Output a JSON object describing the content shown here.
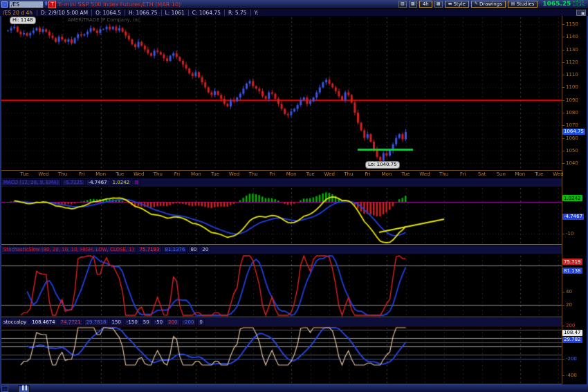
{
  "title_bar": {
    "symbol": "/ES",
    "instrument_badge": "T",
    "title": "E-mini S&P 500 Index Futures,ETH (MAR 10)",
    "timeframe_button": "4h",
    "style_button": "Style",
    "drawings_button": "Drawings",
    "studies_button": "Studies",
    "last_price": "1065.25",
    "change": "+4.25",
    "change_pct": "+0.4%"
  },
  "data_bar": {
    "symbol_info": "/ES 20 d 4h",
    "fields": [
      "D: 2/9/10 5:00 AM",
      "O: 1064.5",
      "H: 1066.75",
      "L: 1061",
      "C: 1064.75",
      "R: 5.75",
      "Y:"
    ]
  },
  "main_chart": {
    "hi_label": "Hi: 1148",
    "lo_label": "Lo: 1040.75",
    "watermark": "AMERITRADE IP Company, Inc.",
    "axis_ticks": [
      "1150",
      "1140",
      "1130",
      "1120",
      "1110",
      "1100",
      "1090",
      "1080",
      "1070",
      "1060",
      "1050",
      "1040"
    ],
    "last_badge": {
      "text": "1064.75",
      "bg": "#1e4fd8",
      "fg": "#ffffff"
    }
  },
  "time_axis": {
    "labels": [
      "Tue",
      "Wed",
      "Thu",
      "Fri",
      "Mon",
      "Tue",
      "Wed",
      "Thu",
      "Fri",
      "Mon",
      "Tue",
      "Wed",
      "Thu",
      "Fri",
      "Mon",
      "Tue",
      "Wed",
      "Thu",
      "Fri",
      "Mon",
      "Tue",
      "Wed",
      "Thu",
      "Fri",
      "Sat",
      "Sun",
      "Mon",
      "Tue",
      "Wed"
    ]
  },
  "macd_panel": {
    "label": "MACD (12, 26, 9, EMA)",
    "label_color": "#3c3cd8",
    "values": [
      {
        "text": "-5.7225",
        "color": "#3c3cd8"
      },
      {
        "text": "-4.7467",
        "color": "#e8e8e8"
      },
      {
        "text": "1.0242",
        "color": "#d8d800"
      },
      {
        "text": "0",
        "color": "#cc00cc"
      }
    ],
    "badges": {
      "diff": {
        "text": "1.0242",
        "bg": "#00c000",
        "fg": "#000000"
      },
      "avg": {
        "text": "-4.7467",
        "bg": "#2040e0",
        "fg": "#ffffff"
      }
    },
    "axis_ticks": [
      {
        "text": "-10",
        "color": "#b87628"
      }
    ]
  },
  "stoch_panel": {
    "label": "StochasticSlow (80, 20, 10, 10, HIGH, LOW, CLOSE, 1)",
    "label_color": "#cc2222",
    "values": [
      {
        "text": "75.7193",
        "color": "#ee3333"
      },
      {
        "text": "81.1376",
        "color": "#4466ee"
      },
      {
        "text": "80",
        "color": "#cccccc"
      },
      {
        "text": "20",
        "color": "#cccccc"
      }
    ],
    "badges": {
      "k": {
        "text": "75.719",
        "bg": "#d02020",
        "fg": "#ffffff"
      },
      "d": {
        "text": "81.138",
        "bg": "#2040e0",
        "fg": "#ffffff"
      }
    },
    "axis_ticks": [
      {
        "text": "40",
        "color": "#b87628"
      },
      {
        "text": "20",
        "color": "#b87628"
      }
    ],
    "hlines": [
      80,
      20
    ]
  },
  "osc_panel": {
    "label": "stoccalpy",
    "label_color": "#dddddd",
    "values": [
      {
        "text": "108.4674",
        "color": "#eeeeee"
      },
      {
        "text": "74.7721",
        "color": "#ee3333"
      },
      {
        "text": "29.7818",
        "color": "#4466ee"
      },
      {
        "text": "150",
        "color": "#cccccc"
      },
      {
        "text": "-150",
        "color": "#cccccc"
      },
      {
        "text": "50",
        "color": "#cccccc"
      },
      {
        "text": "-50",
        "color": "#cccccc"
      },
      {
        "text": "200",
        "color": "#ee3333"
      },
      {
        "text": "-200",
        "color": "#4466ee"
      },
      {
        "text": "0",
        "color": "#cccccc"
      }
    ],
    "badges": {
      "a": {
        "text": "108.47",
        "bg": "#e8e8e8",
        "fg": "#000000"
      },
      "b": {
        "text": "29.782",
        "bg": "#2040e0",
        "fg": "#ffffff"
      }
    },
    "axis_ticks": [
      {
        "text": "200",
        "color": "#d04040"
      },
      {
        "text": "-200",
        "color": "#5070e0"
      },
      {
        "text": "-400",
        "color": "#b87628"
      }
    ],
    "hlines": [
      {
        "v": 200,
        "color": "#cc2222"
      },
      {
        "v": 150,
        "color": "#5a5a5a"
      },
      {
        "v": 50,
        "color": "#9a9a9a"
      },
      {
        "v": 0,
        "color": "#484848"
      },
      {
        "v": -50,
        "color": "#9a9a9a"
      },
      {
        "v": -150,
        "color": "#5a5a5a"
      },
      {
        "v": -200,
        "color": "#3050d0"
      }
    ]
  },
  "chart_data": {
    "type": "candlestick",
    "symbol": "/ES",
    "timeframe": "4h",
    "price_axis": {
      "min": 1040,
      "max": 1150,
      "step": 10
    },
    "red_alert_line_price": 1090,
    "green_support_line": {
      "price": 1051
    },
    "bars_per_day": 6,
    "closes": [
      1145,
      1147,
      1148,
      1144,
      1142,
      1143,
      1141,
      1143,
      1145,
      1147,
      1144,
      1146,
      1144,
      1141,
      1139,
      1136,
      1140,
      1138,
      1136,
      1138,
      1135,
      1139,
      1142,
      1141,
      1142,
      1144,
      1147,
      1145,
      1143,
      1146,
      1146,
      1148,
      1146,
      1148,
      1145,
      1147,
      1144,
      1141,
      1138,
      1134,
      1132,
      1136,
      1133,
      1130,
      1127,
      1125,
      1129,
      1128,
      1126,
      1123,
      1121,
      1125,
      1127,
      1124,
      1121,
      1118,
      1115,
      1111,
      1109,
      1112,
      1108,
      1104,
      1100,
      1096,
      1094,
      1097,
      1094,
      1091,
      1087,
      1085,
      1090,
      1089,
      1092,
      1095,
      1099,
      1103,
      1105,
      1101,
      1099,
      1097,
      1093,
      1091,
      1096,
      1095,
      1091,
      1087,
      1083,
      1079,
      1078,
      1081,
      1083,
      1086,
      1090,
      1092,
      1087,
      1089,
      1092,
      1096,
      1100,
      1104,
      1106,
      1103,
      1100,
      1097,
      1093,
      1090,
      1096,
      1094,
      1088,
      1080,
      1072,
      1066,
      1060,
      1063,
      1057,
      1051,
      1045,
      1042,
      1048,
      1046,
      1050,
      1055,
      1060,
      1063,
      1059,
      1064.75
    ],
    "indicators": {
      "macd": {
        "fast": 12,
        "slow": 26,
        "signal": 9
      },
      "stochastic": {
        "lookback": 8,
        "k_smooth": 2,
        "d_smooth": 6
      },
      "oscillator": {
        "scale": 5.5,
        "b_smooth": 10
      }
    },
    "colors": {
      "up": "#3a55e8",
      "down": "#d42020",
      "macd_value": "#e8e800",
      "macd_avg": "#2040e0",
      "hist_pos": "#00b000",
      "hist_neg": "#cc2020",
      "stoch_k": "#e02020",
      "stoch_d": "#2040e0",
      "osc_a": "#e0c0a0",
      "osc_b": "#2848e8",
      "red_line": "#ff0000",
      "green_line": "#00d830",
      "zero_line": "#b000b0"
    }
  }
}
